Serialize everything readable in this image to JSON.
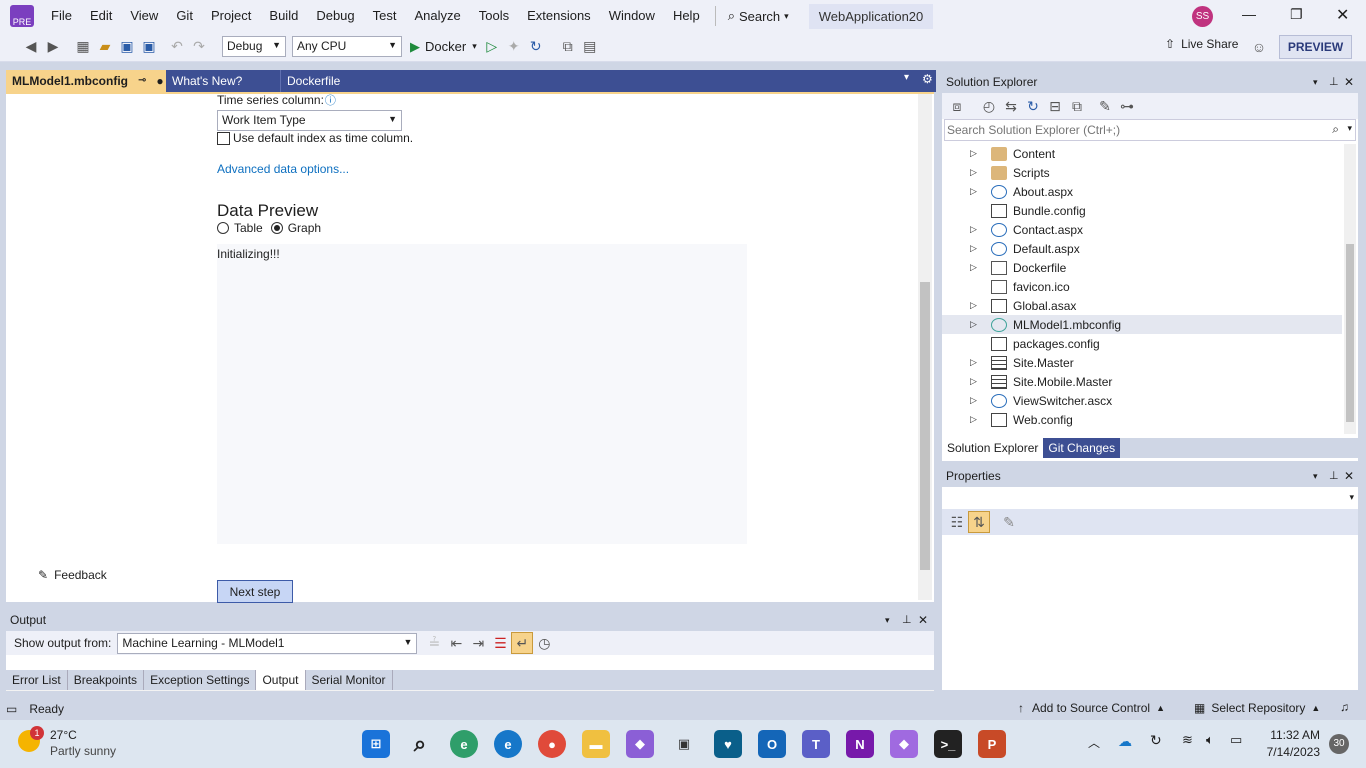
{
  "menu": {
    "items": [
      "File",
      "Edit",
      "View",
      "Git",
      "Project",
      "Build",
      "Debug",
      "Test",
      "Analyze",
      "Tools",
      "Extensions",
      "Window",
      "Help"
    ],
    "search_label": "Search",
    "solution_name": "WebApplication20",
    "user_initials": "SS"
  },
  "toolbar": {
    "config": "Debug",
    "platform": "Any CPU",
    "run_target": "Docker",
    "live_share": "Live Share",
    "preview": "PREVIEW"
  },
  "doc_tabs": {
    "active": "MLModel1.mbconfig",
    "tab2": "What's New?",
    "tab3": "Dockerfile"
  },
  "editor": {
    "time_series_label": "Time series column:",
    "time_series_value": "Work Item Type",
    "use_default_index": "Use default index as time column.",
    "advanced_link": "Advanced data options...",
    "preview_title": "Data Preview",
    "radio_table": "Table",
    "radio_graph": "Graph",
    "preview_status": "Initializing!!!",
    "feedback": "Feedback",
    "next_step": "Next step"
  },
  "output": {
    "title": "Output",
    "show_from_label": "Show output from:",
    "source": "Machine Learning - MLModel1",
    "tabs": [
      "Error List",
      "Breakpoints",
      "Exception Settings",
      "Output",
      "Serial Monitor"
    ]
  },
  "solution_explorer": {
    "title": "Solution Explorer",
    "search_placeholder": "Search Solution Explorer (Ctrl+;)",
    "items": [
      {
        "label": "Content",
        "icon": "folder-icon",
        "expandable": true
      },
      {
        "label": "Scripts",
        "icon": "folder-icon",
        "expandable": true
      },
      {
        "label": "About.aspx",
        "icon": "web-page-icon",
        "expandable": true
      },
      {
        "label": "Bundle.config",
        "icon": "config-icon",
        "expandable": false
      },
      {
        "label": "Contact.aspx",
        "icon": "web-page-icon",
        "expandable": true
      },
      {
        "label": "Default.aspx",
        "icon": "web-page-icon",
        "expandable": true
      },
      {
        "label": "Dockerfile",
        "icon": "file-icon",
        "expandable": true
      },
      {
        "label": "favicon.ico",
        "icon": "file-icon",
        "expandable": false
      },
      {
        "label": "Global.asax",
        "icon": "config-icon",
        "expandable": true
      },
      {
        "label": "MLModel1.mbconfig",
        "icon": "ml-model-icon",
        "expandable": true
      },
      {
        "label": "packages.config",
        "icon": "config-icon",
        "expandable": false
      },
      {
        "label": "Site.Master",
        "icon": "master-page-icon",
        "expandable": true
      },
      {
        "label": "Site.Mobile.Master",
        "icon": "master-page-icon",
        "expandable": true
      },
      {
        "label": "ViewSwitcher.ascx",
        "icon": "web-page-icon",
        "expandable": true
      },
      {
        "label": "Web.config",
        "icon": "config-icon",
        "expandable": true
      }
    ],
    "bottom_tabs": [
      "Solution Explorer",
      "Git Changes"
    ]
  },
  "properties": {
    "title": "Properties"
  },
  "statusbar": {
    "ready": "Ready",
    "add_source_control": "Add to Source Control",
    "select_repository": "Select Repository"
  },
  "taskbar": {
    "weather_temp": "27°C",
    "weather_desc": "Partly sunny",
    "weather_badge": "1",
    "time": "11:32 AM",
    "date": "7/14/2023",
    "notifications": "30"
  },
  "colors": {
    "accent_tab": "#f7d38b",
    "doc_tab_bar": "#3d4f93",
    "link": "#0e70c0",
    "preview_button": "#e0e4f2"
  }
}
